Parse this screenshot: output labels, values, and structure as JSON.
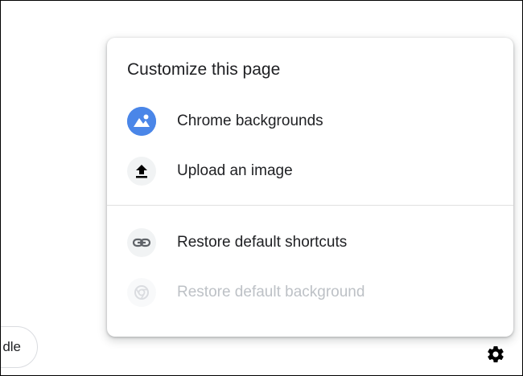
{
  "left_pill": {
    "text": "dle"
  },
  "menu": {
    "title": "Customize this page",
    "items": [
      {
        "label": "Chrome backgrounds",
        "icon": "landscape-icon",
        "enabled": true
      },
      {
        "label": "Upload an image",
        "icon": "upload-icon",
        "enabled": true
      },
      {
        "label": "Restore default shortcuts",
        "icon": "link-icon",
        "enabled": true
      },
      {
        "label": "Restore default background",
        "icon": "chrome-logo-icon",
        "enabled": false
      }
    ]
  },
  "colors": {
    "accent": "#4285f4",
    "text": "#202124",
    "disabled_text": "#bdc1c6",
    "icon_bg": "#f1f3f4",
    "divider": "#e0e0e0"
  },
  "footer": {
    "settings_icon": "gear-icon"
  }
}
